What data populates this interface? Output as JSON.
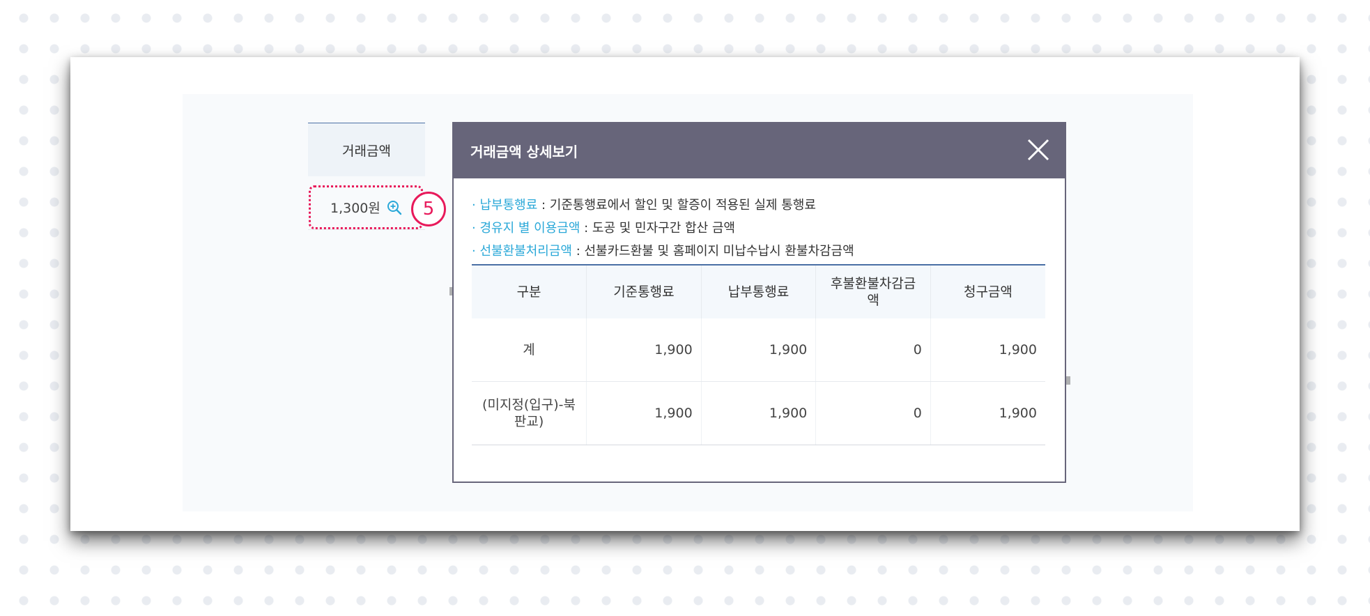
{
  "background_table": {
    "header": "거래금액",
    "amount": "1,300원",
    "step_number": "5"
  },
  "modal": {
    "title": "거래금액 상세보기",
    "notes": [
      {
        "bullet": "·",
        "term": "납부통행료",
        "desc": " : 기준통행료에서 할인 및 할증이 적용된 실제 통행료"
      },
      {
        "bullet": "·",
        "term": "경유지 별 이용금액",
        "desc": " : 도공 및 민자구간 합산 금액"
      },
      {
        "bullet": "·",
        "term": "선불환불처리금액",
        "desc": " : 선불카드환불 및 홈페이지 미납수납시 환불차감금액"
      }
    ],
    "columns": [
      "구분",
      "기준통행료",
      "납부통행료",
      "후불환불차감금액",
      "청구금액"
    ],
    "rows": [
      [
        "계",
        "1,900",
        "1,900",
        "0",
        "1,900"
      ],
      [
        "(미지정(입구)-북판교)",
        "1,900",
        "1,900",
        "0",
        "1,900"
      ]
    ]
  },
  "colors": {
    "accent": "#e8195a",
    "header": "#67657a",
    "link": "#2aa8d8",
    "table_border": "#4a6fa5"
  },
  "icons": {
    "zoom": "zoom-in-icon",
    "close": "close-icon"
  }
}
